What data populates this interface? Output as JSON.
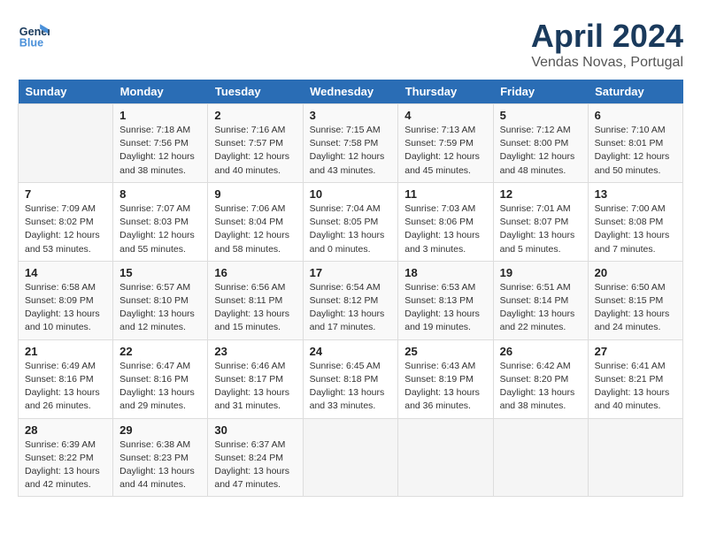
{
  "header": {
    "logo_line1": "General",
    "logo_line2": "Blue",
    "title": "April 2024",
    "subtitle": "Vendas Novas, Portugal"
  },
  "days_of_week": [
    "Sunday",
    "Monday",
    "Tuesday",
    "Wednesday",
    "Thursday",
    "Friday",
    "Saturday"
  ],
  "weeks": [
    [
      {
        "day": "",
        "info": ""
      },
      {
        "day": "1",
        "info": "Sunrise: 7:18 AM\nSunset: 7:56 PM\nDaylight: 12 hours\nand 38 minutes."
      },
      {
        "day": "2",
        "info": "Sunrise: 7:16 AM\nSunset: 7:57 PM\nDaylight: 12 hours\nand 40 minutes."
      },
      {
        "day": "3",
        "info": "Sunrise: 7:15 AM\nSunset: 7:58 PM\nDaylight: 12 hours\nand 43 minutes."
      },
      {
        "day": "4",
        "info": "Sunrise: 7:13 AM\nSunset: 7:59 PM\nDaylight: 12 hours\nand 45 minutes."
      },
      {
        "day": "5",
        "info": "Sunrise: 7:12 AM\nSunset: 8:00 PM\nDaylight: 12 hours\nand 48 minutes."
      },
      {
        "day": "6",
        "info": "Sunrise: 7:10 AM\nSunset: 8:01 PM\nDaylight: 12 hours\nand 50 minutes."
      }
    ],
    [
      {
        "day": "7",
        "info": "Sunrise: 7:09 AM\nSunset: 8:02 PM\nDaylight: 12 hours\nand 53 minutes."
      },
      {
        "day": "8",
        "info": "Sunrise: 7:07 AM\nSunset: 8:03 PM\nDaylight: 12 hours\nand 55 minutes."
      },
      {
        "day": "9",
        "info": "Sunrise: 7:06 AM\nSunset: 8:04 PM\nDaylight: 12 hours\nand 58 minutes."
      },
      {
        "day": "10",
        "info": "Sunrise: 7:04 AM\nSunset: 8:05 PM\nDaylight: 13 hours\nand 0 minutes."
      },
      {
        "day": "11",
        "info": "Sunrise: 7:03 AM\nSunset: 8:06 PM\nDaylight: 13 hours\nand 3 minutes."
      },
      {
        "day": "12",
        "info": "Sunrise: 7:01 AM\nSunset: 8:07 PM\nDaylight: 13 hours\nand 5 minutes."
      },
      {
        "day": "13",
        "info": "Sunrise: 7:00 AM\nSunset: 8:08 PM\nDaylight: 13 hours\nand 7 minutes."
      }
    ],
    [
      {
        "day": "14",
        "info": "Sunrise: 6:58 AM\nSunset: 8:09 PM\nDaylight: 13 hours\nand 10 minutes."
      },
      {
        "day": "15",
        "info": "Sunrise: 6:57 AM\nSunset: 8:10 PM\nDaylight: 13 hours\nand 12 minutes."
      },
      {
        "day": "16",
        "info": "Sunrise: 6:56 AM\nSunset: 8:11 PM\nDaylight: 13 hours\nand 15 minutes."
      },
      {
        "day": "17",
        "info": "Sunrise: 6:54 AM\nSunset: 8:12 PM\nDaylight: 13 hours\nand 17 minutes."
      },
      {
        "day": "18",
        "info": "Sunrise: 6:53 AM\nSunset: 8:13 PM\nDaylight: 13 hours\nand 19 minutes."
      },
      {
        "day": "19",
        "info": "Sunrise: 6:51 AM\nSunset: 8:14 PM\nDaylight: 13 hours\nand 22 minutes."
      },
      {
        "day": "20",
        "info": "Sunrise: 6:50 AM\nSunset: 8:15 PM\nDaylight: 13 hours\nand 24 minutes."
      }
    ],
    [
      {
        "day": "21",
        "info": "Sunrise: 6:49 AM\nSunset: 8:16 PM\nDaylight: 13 hours\nand 26 minutes."
      },
      {
        "day": "22",
        "info": "Sunrise: 6:47 AM\nSunset: 8:16 PM\nDaylight: 13 hours\nand 29 minutes."
      },
      {
        "day": "23",
        "info": "Sunrise: 6:46 AM\nSunset: 8:17 PM\nDaylight: 13 hours\nand 31 minutes."
      },
      {
        "day": "24",
        "info": "Sunrise: 6:45 AM\nSunset: 8:18 PM\nDaylight: 13 hours\nand 33 minutes."
      },
      {
        "day": "25",
        "info": "Sunrise: 6:43 AM\nSunset: 8:19 PM\nDaylight: 13 hours\nand 36 minutes."
      },
      {
        "day": "26",
        "info": "Sunrise: 6:42 AM\nSunset: 8:20 PM\nDaylight: 13 hours\nand 38 minutes."
      },
      {
        "day": "27",
        "info": "Sunrise: 6:41 AM\nSunset: 8:21 PM\nDaylight: 13 hours\nand 40 minutes."
      }
    ],
    [
      {
        "day": "28",
        "info": "Sunrise: 6:39 AM\nSunset: 8:22 PM\nDaylight: 13 hours\nand 42 minutes."
      },
      {
        "day": "29",
        "info": "Sunrise: 6:38 AM\nSunset: 8:23 PM\nDaylight: 13 hours\nand 44 minutes."
      },
      {
        "day": "30",
        "info": "Sunrise: 6:37 AM\nSunset: 8:24 PM\nDaylight: 13 hours\nand 47 minutes."
      },
      {
        "day": "",
        "info": ""
      },
      {
        "day": "",
        "info": ""
      },
      {
        "day": "",
        "info": ""
      },
      {
        "day": "",
        "info": ""
      }
    ]
  ]
}
